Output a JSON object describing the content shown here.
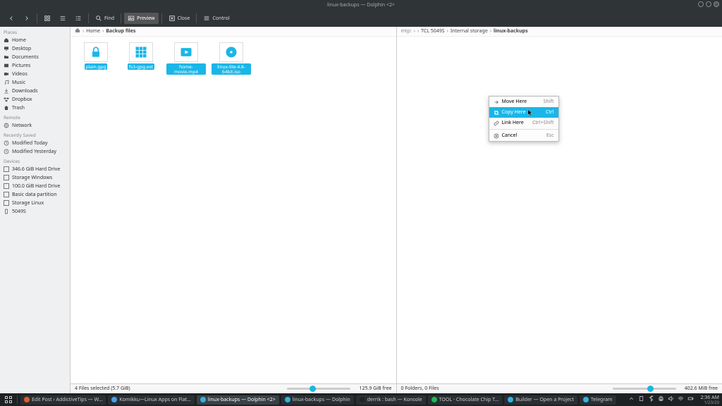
{
  "titlebar": {
    "title": "linux-backups — Dolphin <2>"
  },
  "toolbar": {
    "back": "",
    "forward": "",
    "icons_view": "",
    "compact_view": "",
    "details_view": "",
    "find_label": "Find",
    "preview_label": "Preview",
    "close_label": "Close",
    "control_label": "Control"
  },
  "sidebar": {
    "sections": [
      {
        "title": "Places",
        "items": [
          {
            "label": "Home",
            "icon": "home"
          },
          {
            "label": "Desktop",
            "icon": "desktop"
          },
          {
            "label": "Documents",
            "icon": "folder"
          },
          {
            "label": "Pictures",
            "icon": "image"
          },
          {
            "label": "Videos",
            "icon": "video"
          },
          {
            "label": "Music",
            "icon": "music"
          },
          {
            "label": "Downloads",
            "icon": "download"
          },
          {
            "label": "Dropbox",
            "icon": "dropbox"
          },
          {
            "label": "Trash",
            "icon": "trash"
          }
        ]
      },
      {
        "title": "Remote",
        "items": [
          {
            "label": "Network",
            "icon": "network"
          }
        ]
      },
      {
        "title": "Recently Saved",
        "items": [
          {
            "label": "Modified Today",
            "icon": "clock"
          },
          {
            "label": "Modified Yesterday",
            "icon": "clock"
          }
        ]
      },
      {
        "title": "Devices",
        "items": [
          {
            "label": "346.6 GiB Hard Drive",
            "icon": "drive"
          },
          {
            "label": "Storage Windows",
            "icon": "drive"
          },
          {
            "label": "100.0 GiB Hard Drive",
            "icon": "drive"
          },
          {
            "label": "Basic data partition",
            "icon": "drive"
          },
          {
            "label": "Storage Linux",
            "icon": "drive"
          },
          {
            "label": "5049S",
            "icon": "phone"
          }
        ]
      }
    ]
  },
  "left_pane": {
    "breadcrumb": [
      "Home",
      "Backup files"
    ],
    "files": [
      {
        "label": "plain.gpg",
        "icon": "lock",
        "selected": true
      },
      {
        "label": "fs3-gpg.ext",
        "icon": "grid",
        "selected": true
      },
      {
        "label": "home-movie.mp4",
        "icon": "video",
        "selected": true
      },
      {
        "label": "linux-lite-4.8-64bit.iso",
        "icon": "disc",
        "selected": true
      }
    ],
    "status_left": "4 Files selected (5.7 GiB)",
    "status_right": "125.9 GiB free",
    "zoom_pct": 35
  },
  "right_pane": {
    "breadcrumb_prefix": "mtp:",
    "breadcrumb": [
      "TCL 5049S",
      "Internal storage",
      "linux-backups"
    ],
    "status_left": "0 Folders, 0 Files",
    "status_right": "402.6 MiB free",
    "zoom_pct": 55,
    "context_menu": {
      "items": [
        {
          "label": "Move Here",
          "shortcut": "Shift",
          "icon": "move",
          "hover": false
        },
        {
          "label": "Copy Here",
          "shortcut": "Ctrl",
          "icon": "copy",
          "hover": true
        },
        {
          "label": "Link Here",
          "shortcut": "Ctrl+Shift",
          "icon": "link",
          "hover": false
        }
      ],
      "cancel": {
        "label": "Cancel",
        "shortcut": "Esc",
        "icon": "cancel"
      }
    }
  },
  "taskbar": {
    "tasks": [
      {
        "label": "Edit Post ‹ AddictiveTips — W…",
        "color": "#e05d2b",
        "active": false
      },
      {
        "label": "Komikku—Linux Apps on Flat…",
        "color": "#49a0e8",
        "active": false
      },
      {
        "label": "linux-backups — Dolphin <2>",
        "color": "#2fb4e6",
        "active": true
      },
      {
        "label": "linux-backups — Dolphin",
        "color": "#2fb4e6",
        "active": false
      },
      {
        "label": "derrik : bash — Konsole",
        "color": "#222",
        "active": false
      },
      {
        "label": "TOOL - Chocolate Chip T…",
        "color": "#1db954",
        "active": false
      },
      {
        "label": "Builder — Open a Project",
        "color": "#2fb4e6",
        "active": false
      },
      {
        "label": "Telegram",
        "color": "#2fb4e6",
        "active": false
      }
    ],
    "clock_time": "2:36 AM",
    "clock_date": "1/23/20"
  }
}
